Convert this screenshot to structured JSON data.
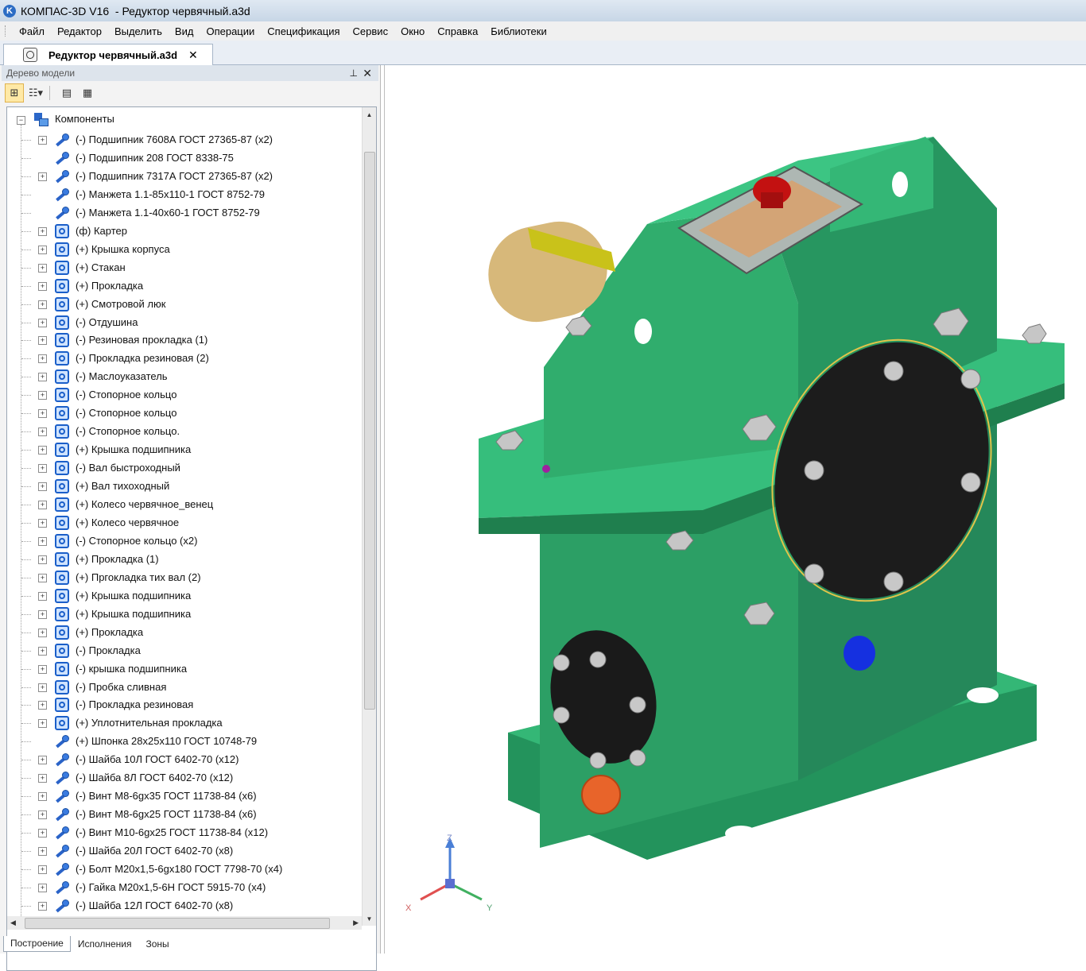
{
  "window": {
    "title": "КОМПАС-3D V16  - Редуктор червячный.a3d",
    "app_icon": "kompas-logo-icon"
  },
  "menu": [
    "Файл",
    "Редактор",
    "Выделить",
    "Вид",
    "Операции",
    "Спецификация",
    "Сервис",
    "Окно",
    "Справка",
    "Библиотеки"
  ],
  "document_tab": {
    "label": "Редуктор червячный.a3d",
    "close_glyph": "✕"
  },
  "model_tree": {
    "panel_title": "Дерево модели",
    "root_label": "Компоненты",
    "items": [
      {
        "label": "(-) Подшипник 7608А ГОСТ 27365-87 (x2)",
        "icon": "standard-part-icon",
        "expandable": true
      },
      {
        "label": "(-) Подшипник 208 ГОСТ 8338-75",
        "icon": "standard-part-icon",
        "expandable": false
      },
      {
        "label": "(-) Подшипник 7317А ГОСТ 27365-87 (x2)",
        "icon": "standard-part-icon",
        "expandable": true
      },
      {
        "label": "(-) Манжета 1.1-85x110-1 ГОСТ 8752-79",
        "icon": "standard-part-icon",
        "expandable": false
      },
      {
        "label": "(-) Манжета 1.1-40x60-1 ГОСТ 8752-79",
        "icon": "standard-part-icon",
        "expandable": false
      },
      {
        "label": "(ф) Картер",
        "icon": "part-icon",
        "expandable": true
      },
      {
        "label": "(+) Крышка корпуса",
        "icon": "part-icon",
        "expandable": true
      },
      {
        "label": "(+) Стакан",
        "icon": "part-icon",
        "expandable": true
      },
      {
        "label": "(+) Прокладка",
        "icon": "part-icon",
        "expandable": true
      },
      {
        "label": "(+) Смотровой люк",
        "icon": "part-icon",
        "expandable": true
      },
      {
        "label": "(-) Отдушина",
        "icon": "part-icon",
        "expandable": true
      },
      {
        "label": "(-) Резиновая прокладка (1)",
        "icon": "part-icon",
        "expandable": true
      },
      {
        "label": "(-) Прокладка резиновая (2)",
        "icon": "part-icon",
        "expandable": true
      },
      {
        "label": "(-) Маслоуказатель",
        "icon": "part-icon",
        "expandable": true
      },
      {
        "label": "(-) Стопорное кольцо",
        "icon": "part-icon",
        "expandable": true
      },
      {
        "label": "(-) Стопорное кольцо",
        "icon": "part-icon",
        "expandable": true
      },
      {
        "label": "(-) Стопорное кольцо.",
        "icon": "part-icon",
        "expandable": true
      },
      {
        "label": "(+) Крышка подшипника",
        "icon": "part-icon",
        "expandable": true
      },
      {
        "label": "(-) Вал быстроходный",
        "icon": "part-icon",
        "expandable": true
      },
      {
        "label": "(+) Вал тихоходный",
        "icon": "part-icon",
        "expandable": true
      },
      {
        "label": "(+) Колесо червячное_венец",
        "icon": "part-icon",
        "expandable": true
      },
      {
        "label": "(+) Колесо червячное",
        "icon": "part-icon",
        "expandable": true
      },
      {
        "label": "(-) Стопорное кольцо  (x2)",
        "icon": "part-icon",
        "expandable": true
      },
      {
        "label": "(+) Прокладка (1)",
        "icon": "part-icon",
        "expandable": true
      },
      {
        "label": "(+) Пргокладка тих вал (2)",
        "icon": "part-icon",
        "expandable": true
      },
      {
        "label": "(+) Крышка подшипника",
        "icon": "part-icon",
        "expandable": true
      },
      {
        "label": "(+) Крышка подшипника",
        "icon": "part-icon",
        "expandable": true
      },
      {
        "label": "(+) Прокладка",
        "icon": "part-icon",
        "expandable": true
      },
      {
        "label": "(-) Прокладка",
        "icon": "part-icon",
        "expandable": true
      },
      {
        "label": "(-) крышка подшипника",
        "icon": "part-icon",
        "expandable": true
      },
      {
        "label": "(-) Пробка сливная",
        "icon": "part-icon",
        "expandable": true
      },
      {
        "label": "(-) Прокладка резиновая",
        "icon": "part-icon",
        "expandable": true
      },
      {
        "label": "(+) Уплотнительная прокладка",
        "icon": "part-icon",
        "expandable": true
      },
      {
        "label": "(+) Шпонка 28x25x110 ГОСТ 10748-79",
        "icon": "standard-part-icon",
        "expandable": false
      },
      {
        "label": "(-) Шайба 10Л ГОСТ 6402-70 (x12)",
        "icon": "standard-part-icon",
        "expandable": true
      },
      {
        "label": "(-) Шайба 8Л ГОСТ 6402-70 (x12)",
        "icon": "standard-part-icon",
        "expandable": true
      },
      {
        "label": "(-) Винт М8-6gx35 ГОСТ 11738-84 (x6)",
        "icon": "standard-part-icon",
        "expandable": true
      },
      {
        "label": "(-) Винт М8-6gx25 ГОСТ 11738-84 (x6)",
        "icon": "standard-part-icon",
        "expandable": true
      },
      {
        "label": "(-) Винт М10-6gx25 ГОСТ 11738-84 (x12)",
        "icon": "standard-part-icon",
        "expandable": true
      },
      {
        "label": "(-) Шайба 20Л ГОСТ 6402-70 (x8)",
        "icon": "standard-part-icon",
        "expandable": true
      },
      {
        "label": "(-) Болт М20x1,5-6gx180 ГОСТ 7798-70 (x4)",
        "icon": "standard-part-icon",
        "expandable": true
      },
      {
        "label": "(-) Гайка М20x1,5-6Н ГОСТ 5915-70 (x4)",
        "icon": "standard-part-icon",
        "expandable": true
      },
      {
        "label": "(-) Шайба 12Л ГОСТ 6402-70 (x8)",
        "icon": "standard-part-icon",
        "expandable": true
      }
    ],
    "bottom_tabs": [
      "Построение",
      "Исполнения",
      "Зоны"
    ],
    "active_bottom_tab": 0
  },
  "viewport": {
    "triad_labels": {
      "x": "X",
      "y": "Y",
      "z": "Z"
    },
    "colors": {
      "housing": "#2eaa6c",
      "housing_dark": "#1e8550",
      "cover": "#1c1c1c",
      "shaft": "#d7b87a",
      "key": "#c9c21a",
      "cap": "#cc1414",
      "plug": "#e8642a",
      "bolt": "#c8c8c8",
      "oil_indicator": "#1530e0"
    }
  }
}
